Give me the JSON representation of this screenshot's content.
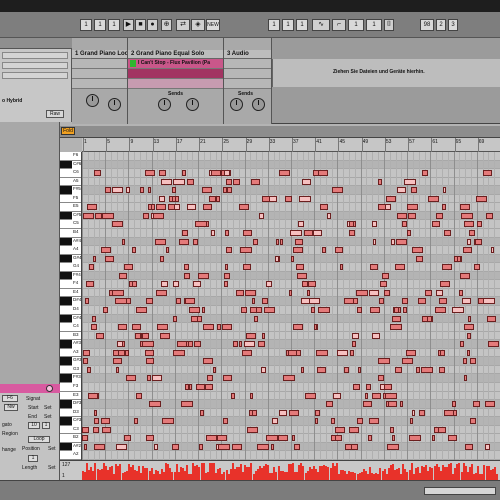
{
  "transport": {
    "position_1": "1",
    "position_2": "1",
    "position_3": "1",
    "new_label": "NEW",
    "quantize": "1 Bar",
    "right_1": "98",
    "right_2": "2",
    "right_3": "3"
  },
  "browser": {
    "visible_item": "o Hybrid",
    "raw_button": "Raw"
  },
  "session": {
    "tracks": [
      {
        "title": "1 Grand Piano Loo"
      },
      {
        "title": "2 Grand Piano Equal Solo"
      },
      {
        "title": "3 Audio"
      }
    ],
    "clip_name": "I Can't Stop - Flux Pavilion (Pa",
    "drop_hint": "Ziehen Sie Dateien und Geräte hierhin.",
    "sends_label": "Sends"
  },
  "piano_roll": {
    "fold_label": "Fold",
    "ruler_ticks": [
      "1",
      "5",
      "9",
      "13",
      "17",
      "21",
      "25",
      "29",
      "33",
      "37",
      "41",
      "45",
      "49",
      "53",
      "57",
      "61",
      "65",
      "69"
    ],
    "key_labels": [
      "F6",
      "C#6",
      "C6",
      "A5",
      "F#5",
      "F5",
      "E5",
      "C#5",
      "C5",
      "B4",
      "A#4",
      "A4",
      "G#4",
      "G4",
      "F#4",
      "F4",
      "E4",
      "D#4",
      "D4",
      "C#4",
      "C4",
      "B3",
      "A#3",
      "A3",
      "G#3",
      "G3",
      "F#3",
      "F3",
      "E3",
      "D#3",
      "D3",
      "C#3",
      "C3",
      "B2",
      "A#2",
      "A2"
    ],
    "velocity_top": "127",
    "velocity_bottom": "1"
  },
  "clip_box": {
    "sig_label": "Signat",
    "start_label": "Start",
    "end_label": "End",
    "loop_label": "Loop",
    "position_label": "Position",
    "length_label": "Length",
    "set_label": "Set",
    "field_F6": "F6",
    "field_nw": "Nw",
    "field_10": "10",
    "field_1": "1",
    "field_lgato": "gato",
    "field_region": "Region",
    "change_label": "hange",
    "set2": "Set",
    "set3": "Set",
    "value_1": "1"
  },
  "colors": {
    "note_fill": "#e47a7a",
    "note_selected": "#f6c0c0",
    "velocity": "#e8322a",
    "clip_header": "#d85aa0",
    "fold": "#f0a020",
    "clip_green": "#2fb52f"
  }
}
